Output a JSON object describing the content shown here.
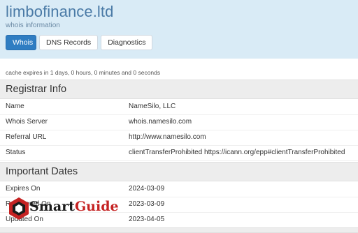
{
  "header": {
    "title": "limbofinance.ltd",
    "subtitle": "whois information",
    "tabs": [
      {
        "label": "Whois",
        "active": true
      },
      {
        "label": "DNS Records",
        "active": false
      },
      {
        "label": "Diagnostics",
        "active": false
      }
    ]
  },
  "cache_note": "cache expires in 1 days, 0 hours, 0 minutes and 0 seconds",
  "registrar_info": {
    "heading": "Registrar Info",
    "rows": [
      {
        "key": "Name",
        "value": "NameSilo, LLC"
      },
      {
        "key": "Whois Server",
        "value": "whois.namesilo.com"
      },
      {
        "key": "Referral URL",
        "value": "http://www.namesilo.com"
      },
      {
        "key": "Status",
        "value": "clientTransferProhibited https://icann.org/epp#clientTransferProhibited"
      }
    ]
  },
  "important_dates": {
    "heading": "Important Dates",
    "rows": [
      {
        "key": "Expires On",
        "value": "2024-03-09"
      },
      {
        "key": "Registered On",
        "value": "2023-03-09"
      },
      {
        "key": "Updated On",
        "value": "2023-04-05"
      }
    ]
  },
  "watermark": {
    "text_a": "Smart",
    "text_b": "Guide",
    "icon": "hexagon-logo-icon"
  },
  "colors": {
    "header_bg": "#d9ebf6",
    "title": "#4a7aa6",
    "tab_active": "#2f7dc2",
    "section_bg": "#ededed",
    "watermark_red": "#c52222"
  }
}
